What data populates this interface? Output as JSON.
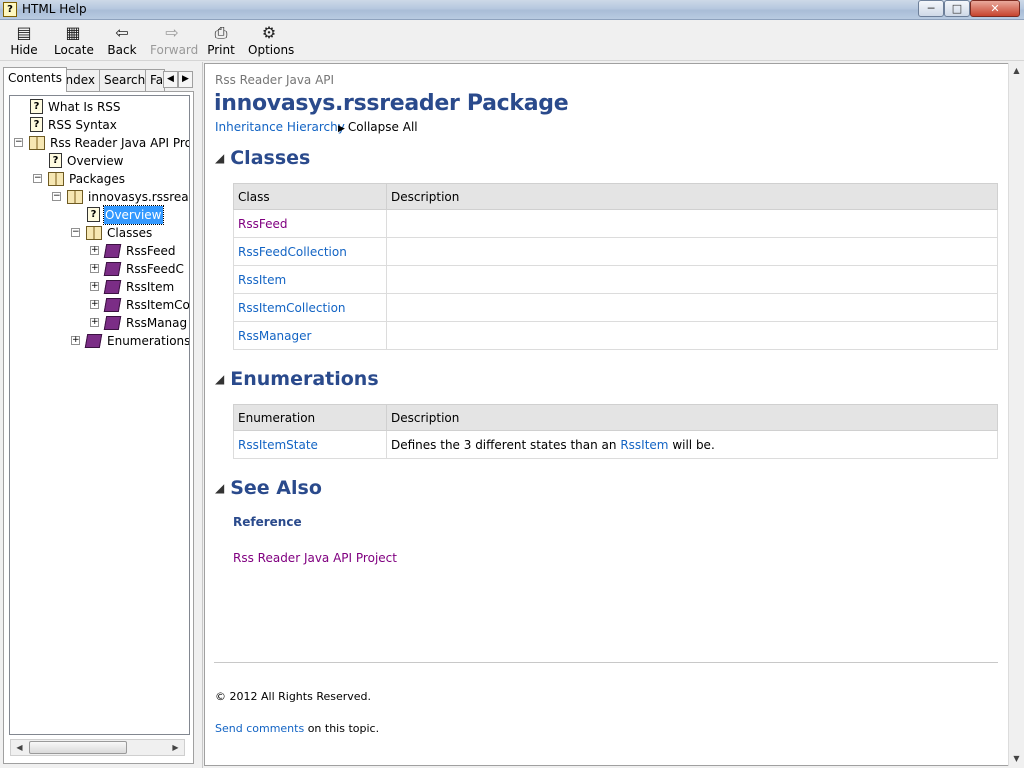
{
  "window": {
    "title": "HTML Help"
  },
  "title_buttons": {
    "minimize": "─",
    "maximize": "□",
    "close": "✕"
  },
  "toolbar": {
    "hide": {
      "label": "Hide",
      "icon": "hide-pane-icon"
    },
    "locate": {
      "label": "Locate",
      "icon": "locate-icon"
    },
    "back": {
      "label": "Back",
      "icon": "back-arrow-icon"
    },
    "forward": {
      "label": "Forward",
      "icon": "forward-arrow-icon",
      "disabled": true
    },
    "print": {
      "label": "Print",
      "icon": "printer-icon"
    },
    "options": {
      "label": "Options",
      "icon": "options-icon"
    }
  },
  "tabs": [
    {
      "label": "Contents",
      "active": true
    },
    {
      "label": "Index"
    },
    {
      "label": "Search"
    },
    {
      "label": "Fa"
    }
  ],
  "tree": [
    {
      "label": "What Is RSS",
      "icon": "help-page-icon"
    },
    {
      "label": "RSS Syntax",
      "icon": "help-page-icon"
    },
    {
      "label": "Rss Reader Java API Pro",
      "icon": "open-book-icon",
      "expander": "⊟"
    },
    {
      "label": "Overview",
      "icon": "help-page-icon"
    },
    {
      "label": "Packages",
      "icon": "open-book-icon",
      "expander": "⊟"
    },
    {
      "label": "innovasys.rssreader",
      "icon": "open-book-icon",
      "expander": "⊟"
    },
    {
      "label": "Overview",
      "icon": "help-page-icon",
      "selected": true
    },
    {
      "label": "Classes",
      "icon": "open-book-icon",
      "expander": "⊟"
    },
    {
      "label": "RssFeed",
      "icon": "closed-book-icon",
      "expander": "⊞"
    },
    {
      "label": "RssFeedC",
      "icon": "closed-book-icon",
      "expander": "⊞"
    },
    {
      "label": "RssItem",
      "icon": "closed-book-icon",
      "expander": "⊞"
    },
    {
      "label": "RssItemCo",
      "icon": "closed-book-icon",
      "expander": "⊞"
    },
    {
      "label": "RssManag",
      "icon": "closed-book-icon",
      "expander": "⊞"
    },
    {
      "label": "Enumerations",
      "icon": "closed-book-icon",
      "expander": "⊞"
    }
  ],
  "content": {
    "api_label": "Rss Reader Java API",
    "title": "innovasys.rssreader Package",
    "inheritance_link": "Inheritance Hierarchy",
    "collapse_all": "Collapse All",
    "classes": {
      "heading": "Classes",
      "headers": [
        "Class",
        "Description"
      ],
      "rows": [
        {
          "name": "RssFeed",
          "description": "",
          "visited": true
        },
        {
          "name": "RssFeedCollection",
          "description": ""
        },
        {
          "name": "RssItem",
          "description": ""
        },
        {
          "name": "RssItemCollection",
          "description": ""
        },
        {
          "name": "RssManager",
          "description": ""
        }
      ]
    },
    "enumerations": {
      "heading": "Enumerations",
      "headers": [
        "Enumeration",
        "Description"
      ],
      "rows": [
        {
          "name": "RssItemState",
          "description_prefix": "Defines the 3 different states than an",
          "description_link": "RssItem",
          "description_suffix": "will be."
        }
      ]
    },
    "see_also": {
      "heading": "See Also",
      "reference_heading": "Reference",
      "project_link": "Rss Reader Java API Project"
    },
    "footer": {
      "copyright": "© 2012 All Rights Reserved.",
      "send_comments": "Send comments",
      "send_suffix": "on this topic."
    }
  }
}
